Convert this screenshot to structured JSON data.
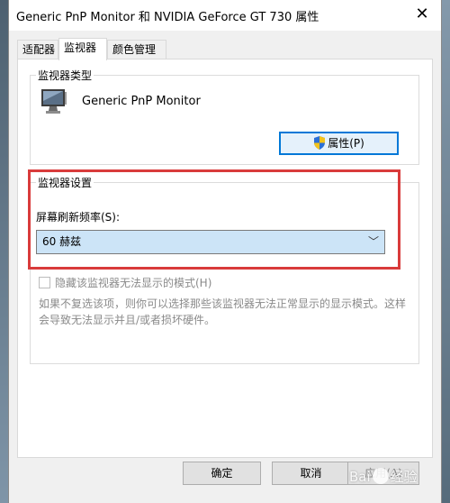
{
  "window": {
    "title": "Generic PnP Monitor 和 NVIDIA GeForce GT 730 属性",
    "close_glyph": "✕"
  },
  "tabs": [
    {
      "label": "适配器",
      "active": false
    },
    {
      "label": "监视器",
      "active": true
    },
    {
      "label": "颜色管理",
      "active": false
    }
  ],
  "monitor_type": {
    "group_label": "监视器类型",
    "monitor_name": "Generic PnP Monitor",
    "properties_button": "属性(P)",
    "icon": "monitor-icon"
  },
  "monitor_settings": {
    "group_label": "监视器设置",
    "refresh_label": "屏幕刷新频率(S):",
    "refresh_value": "60 赫兹",
    "hide_modes_label": "隐藏该监视器无法显示的模式(H)",
    "hide_modes_checked": false,
    "description": "如果不复选该项，则你可以选择那些该监视器无法正常显示的显示模式。这样会导致无法显示并且/或者损坏硬件。"
  },
  "buttons": {
    "ok": "确定",
    "cancel": "取消",
    "apply": "应用(A)"
  },
  "watermark": {
    "text_left": "Bai",
    "text_right": "经验"
  },
  "colors": {
    "highlight": "#d93b3b",
    "focus_border": "#0078d7",
    "select_bg": "#cce4f7"
  }
}
